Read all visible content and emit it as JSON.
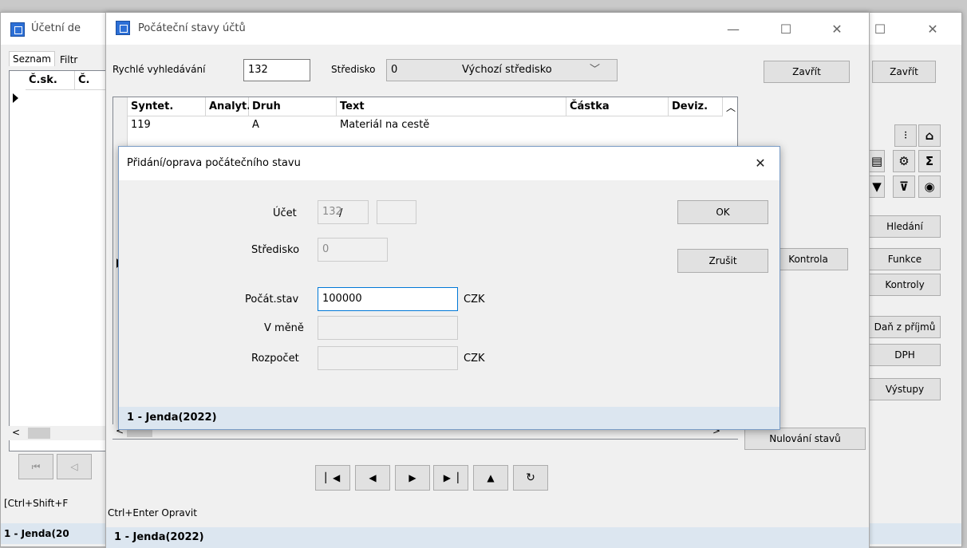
{
  "main_window": {
    "title": "Účetní de",
    "tabs": [
      "Seznam",
      "Filtr"
    ],
    "columns": [
      "Č.sk.",
      "Č."
    ],
    "nav_buttons": [
      "⏮",
      "◁"
    ],
    "footer_hint": "[Ctrl+Shift+F",
    "status": "1 - Jenda(20",
    "close_btn": "Zavřít",
    "side_buttons": [
      "Hledání",
      "Funkce",
      "Kontroly",
      "Daň z příjmů",
      "DPH",
      "Výstupy"
    ],
    "icons": [
      "chart-icon",
      "bank-icon",
      "document-icon",
      "gear-icon",
      "sigma-icon",
      "filter-icon",
      "clear-filter-icon",
      "eye-icon"
    ],
    "minimize": "☐",
    "close": "✕"
  },
  "opening_window": {
    "title": "Počáteční stavy účtů",
    "search_label": "Rychlé vyhledávání",
    "search_value": "132",
    "center_label": "Středisko",
    "center_code": "0",
    "center_name": "Výchozí středisko",
    "close_btn": "Zavřít",
    "kontrola_btn": "Kontrola",
    "nulovani_btn": "Nulování stavů",
    "grid_headers": [
      "Syntet.",
      "Analyt.",
      "Druh",
      "Text",
      "Částka",
      "Deviz."
    ],
    "grid_rows": [
      {
        "syntet": "119",
        "analyt": "",
        "druh": "A",
        "text": "Materiál na cestě",
        "castka": "",
        "deviz": ""
      }
    ],
    "hint": "Ctrl+Enter Opravit",
    "status": "1 - Jenda(2022)",
    "wctl": [
      "—",
      "☐",
      "✕"
    ]
  },
  "dialog": {
    "title": "Přidání/oprava počátečního stavu",
    "close": "✕",
    "ucet_label": "Účet",
    "ucet_value": "132",
    "ucet_sep": "/",
    "ucet_analyt": "",
    "stredisko_label": "Středisko",
    "stredisko_value": "0",
    "pocat_label": "Počát.stav",
    "pocat_value": "100000",
    "pocat_currency": "CZK",
    "vmene_label": "V měně",
    "vmene_value": "",
    "rozpocet_label": "Rozpočet",
    "rozpocet_value": "",
    "rozpocet_currency": "CZK",
    "ok_btn": "OK",
    "cancel_btn": "Zrušit",
    "status": "1 - Jenda(2022)"
  }
}
